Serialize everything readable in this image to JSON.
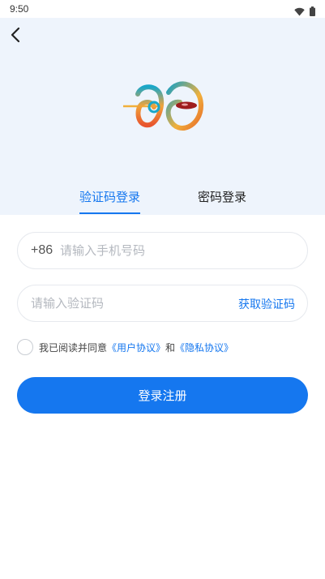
{
  "status_bar": {
    "time": "9:50",
    "icons": [
      "wifi-icon",
      "battery-icon"
    ]
  },
  "header": {
    "back_icon": "back-arrow-icon"
  },
  "tabs": [
    {
      "label": "验证码登录",
      "active": true
    },
    {
      "label": "密码登录",
      "active": false
    }
  ],
  "phone_field": {
    "country_code": "+86",
    "placeholder": "请输入手机号码",
    "value": ""
  },
  "code_field": {
    "placeholder": "请输入验证码",
    "value": "",
    "get_code_label": "获取验证码"
  },
  "agreement": {
    "checked": false,
    "prefix": "我已阅读并同意",
    "user_agreement": "《用户协议》",
    "conjunction": "和",
    "privacy_policy": "《隐私协议》"
  },
  "submit_label": "登录注册",
  "colors": {
    "accent": "#1577ef",
    "hero_bg": "#eef4fc"
  }
}
